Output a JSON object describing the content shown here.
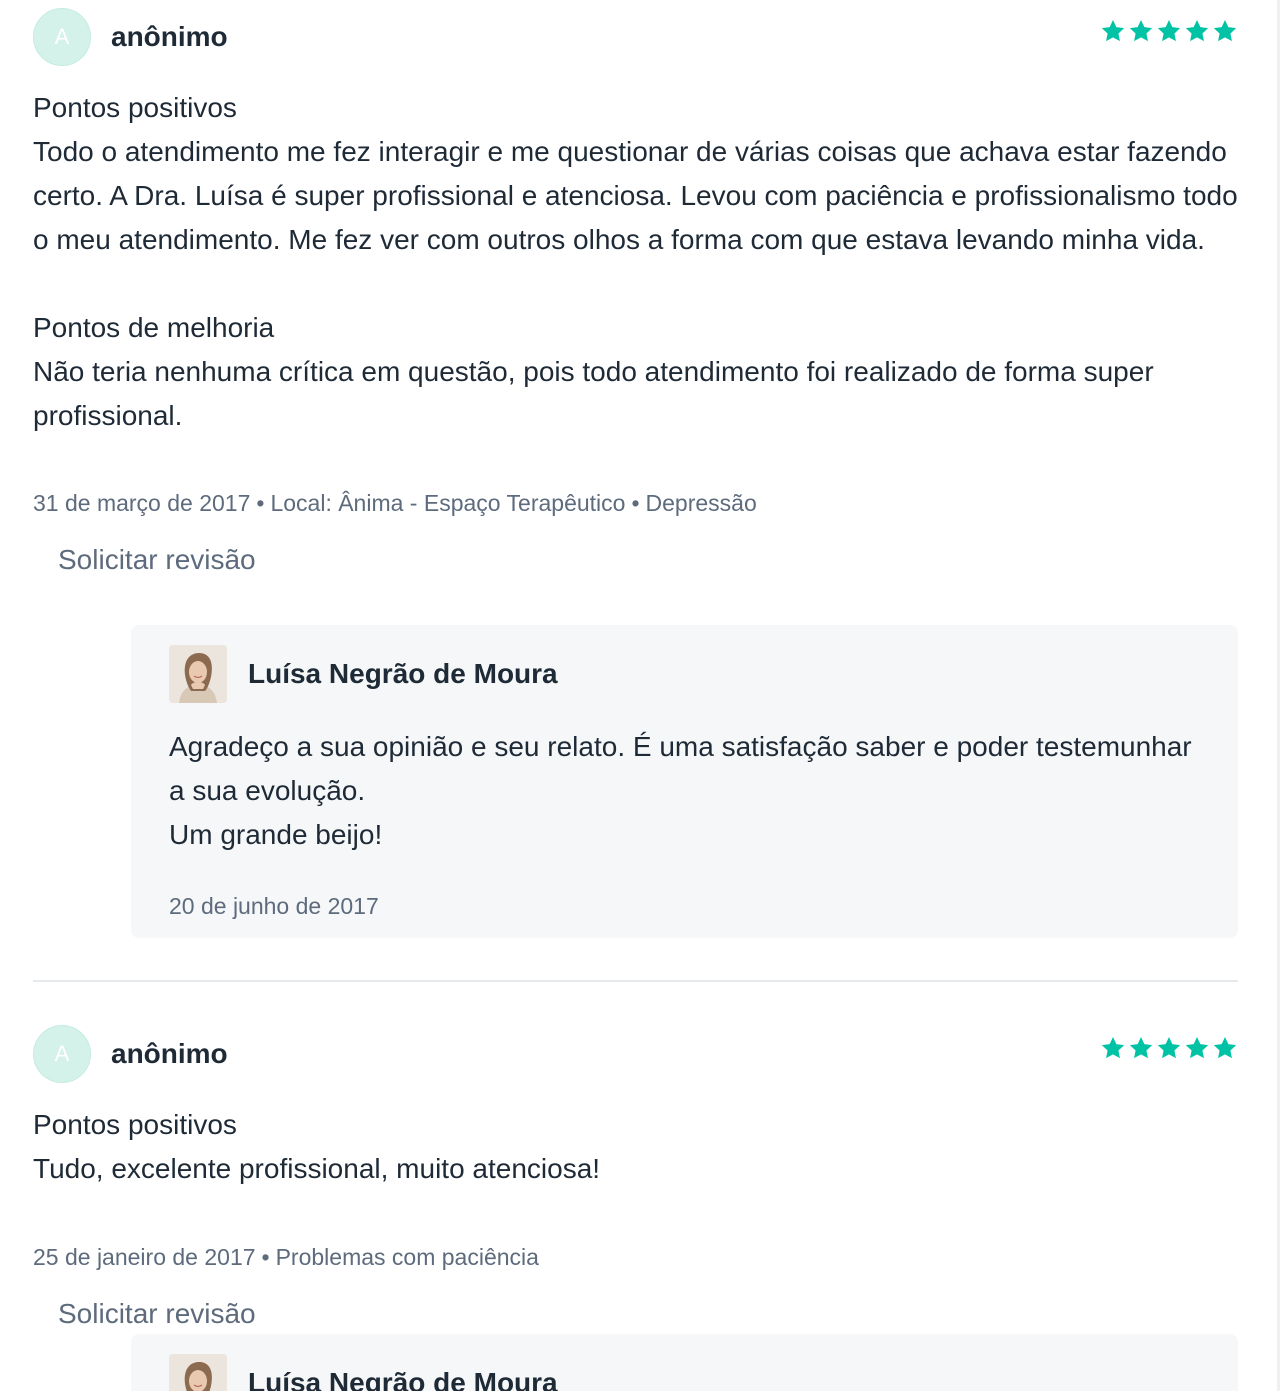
{
  "reviews": [
    {
      "avatar_letter": "A",
      "author": "anônimo",
      "rating": 5,
      "positives_title": "Pontos positivos",
      "positives_text": "Todo o atendimento me fez interagir e me questionar de várias coisas que achava estar fazendo certo. A Dra. Luísa é super profissional e atenciosa. Levou com paciência e profissionalismo todo o meu atendimento. Me fez ver com outros olhos a forma com que estava levando minha vida.",
      "improvements_title": "Pontos de melhoria",
      "improvements_text": "Não teria nenhuma crítica em questão, pois todo atendimento foi realizado de forma super profissional.",
      "date": "31 de março de 2017",
      "location": "Local: Ânima - Espaço Terapêutico",
      "topic": "Depressão",
      "request_review_label": "Solicitar revisão",
      "reply": {
        "name": "Luísa Negrão de Moura",
        "text_lines": [
          "Agradeço a sua opinião e seu relato. É uma satisfação saber e poder testemunhar a sua evolução.",
          "Um grande beijo!"
        ],
        "date": "20 de junho de 2017"
      }
    },
    {
      "avatar_letter": "A",
      "author": "anônimo",
      "rating": 5,
      "positives_title": "Pontos positivos",
      "positives_text": "Tudo, excelente profissional, muito atenciosa!",
      "date": "25 de janeiro de 2017",
      "topic": "Problemas com paciência",
      "request_review_label": "Solicitar revisão",
      "reply": {
        "name": "Luísa Negrão de Moura"
      }
    }
  ],
  "meta_separator": "•",
  "colors": {
    "star": "#00c3a5",
    "avatar_bg": "#d4f2ea",
    "text": "#1f2a37",
    "muted": "#5d6b7d",
    "reply_bg": "#f5f7f8"
  },
  "icons": {
    "star": "star-icon",
    "pro_photo": "professional-photo"
  }
}
